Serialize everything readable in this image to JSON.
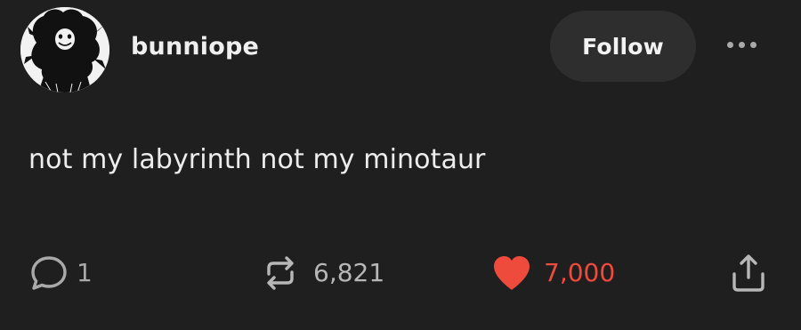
{
  "post": {
    "username": "bunniope",
    "follow_label": "Follow",
    "text": "not my labyrinth not my minotaur"
  },
  "actions": {
    "comments": {
      "icon": "comment-icon",
      "count": "1"
    },
    "reblogs": {
      "icon": "reblog-icon",
      "count": "6,821"
    },
    "likes": {
      "icon": "heart-icon",
      "count": "7,000",
      "liked": true
    },
    "share": {
      "icon": "share-icon"
    }
  },
  "colors": {
    "background": "#1f1f1f",
    "text": "#ececec",
    "muted": "#a9a9a9",
    "follow_button": "#2e2e2e",
    "like_red": "#ee4b3c"
  }
}
